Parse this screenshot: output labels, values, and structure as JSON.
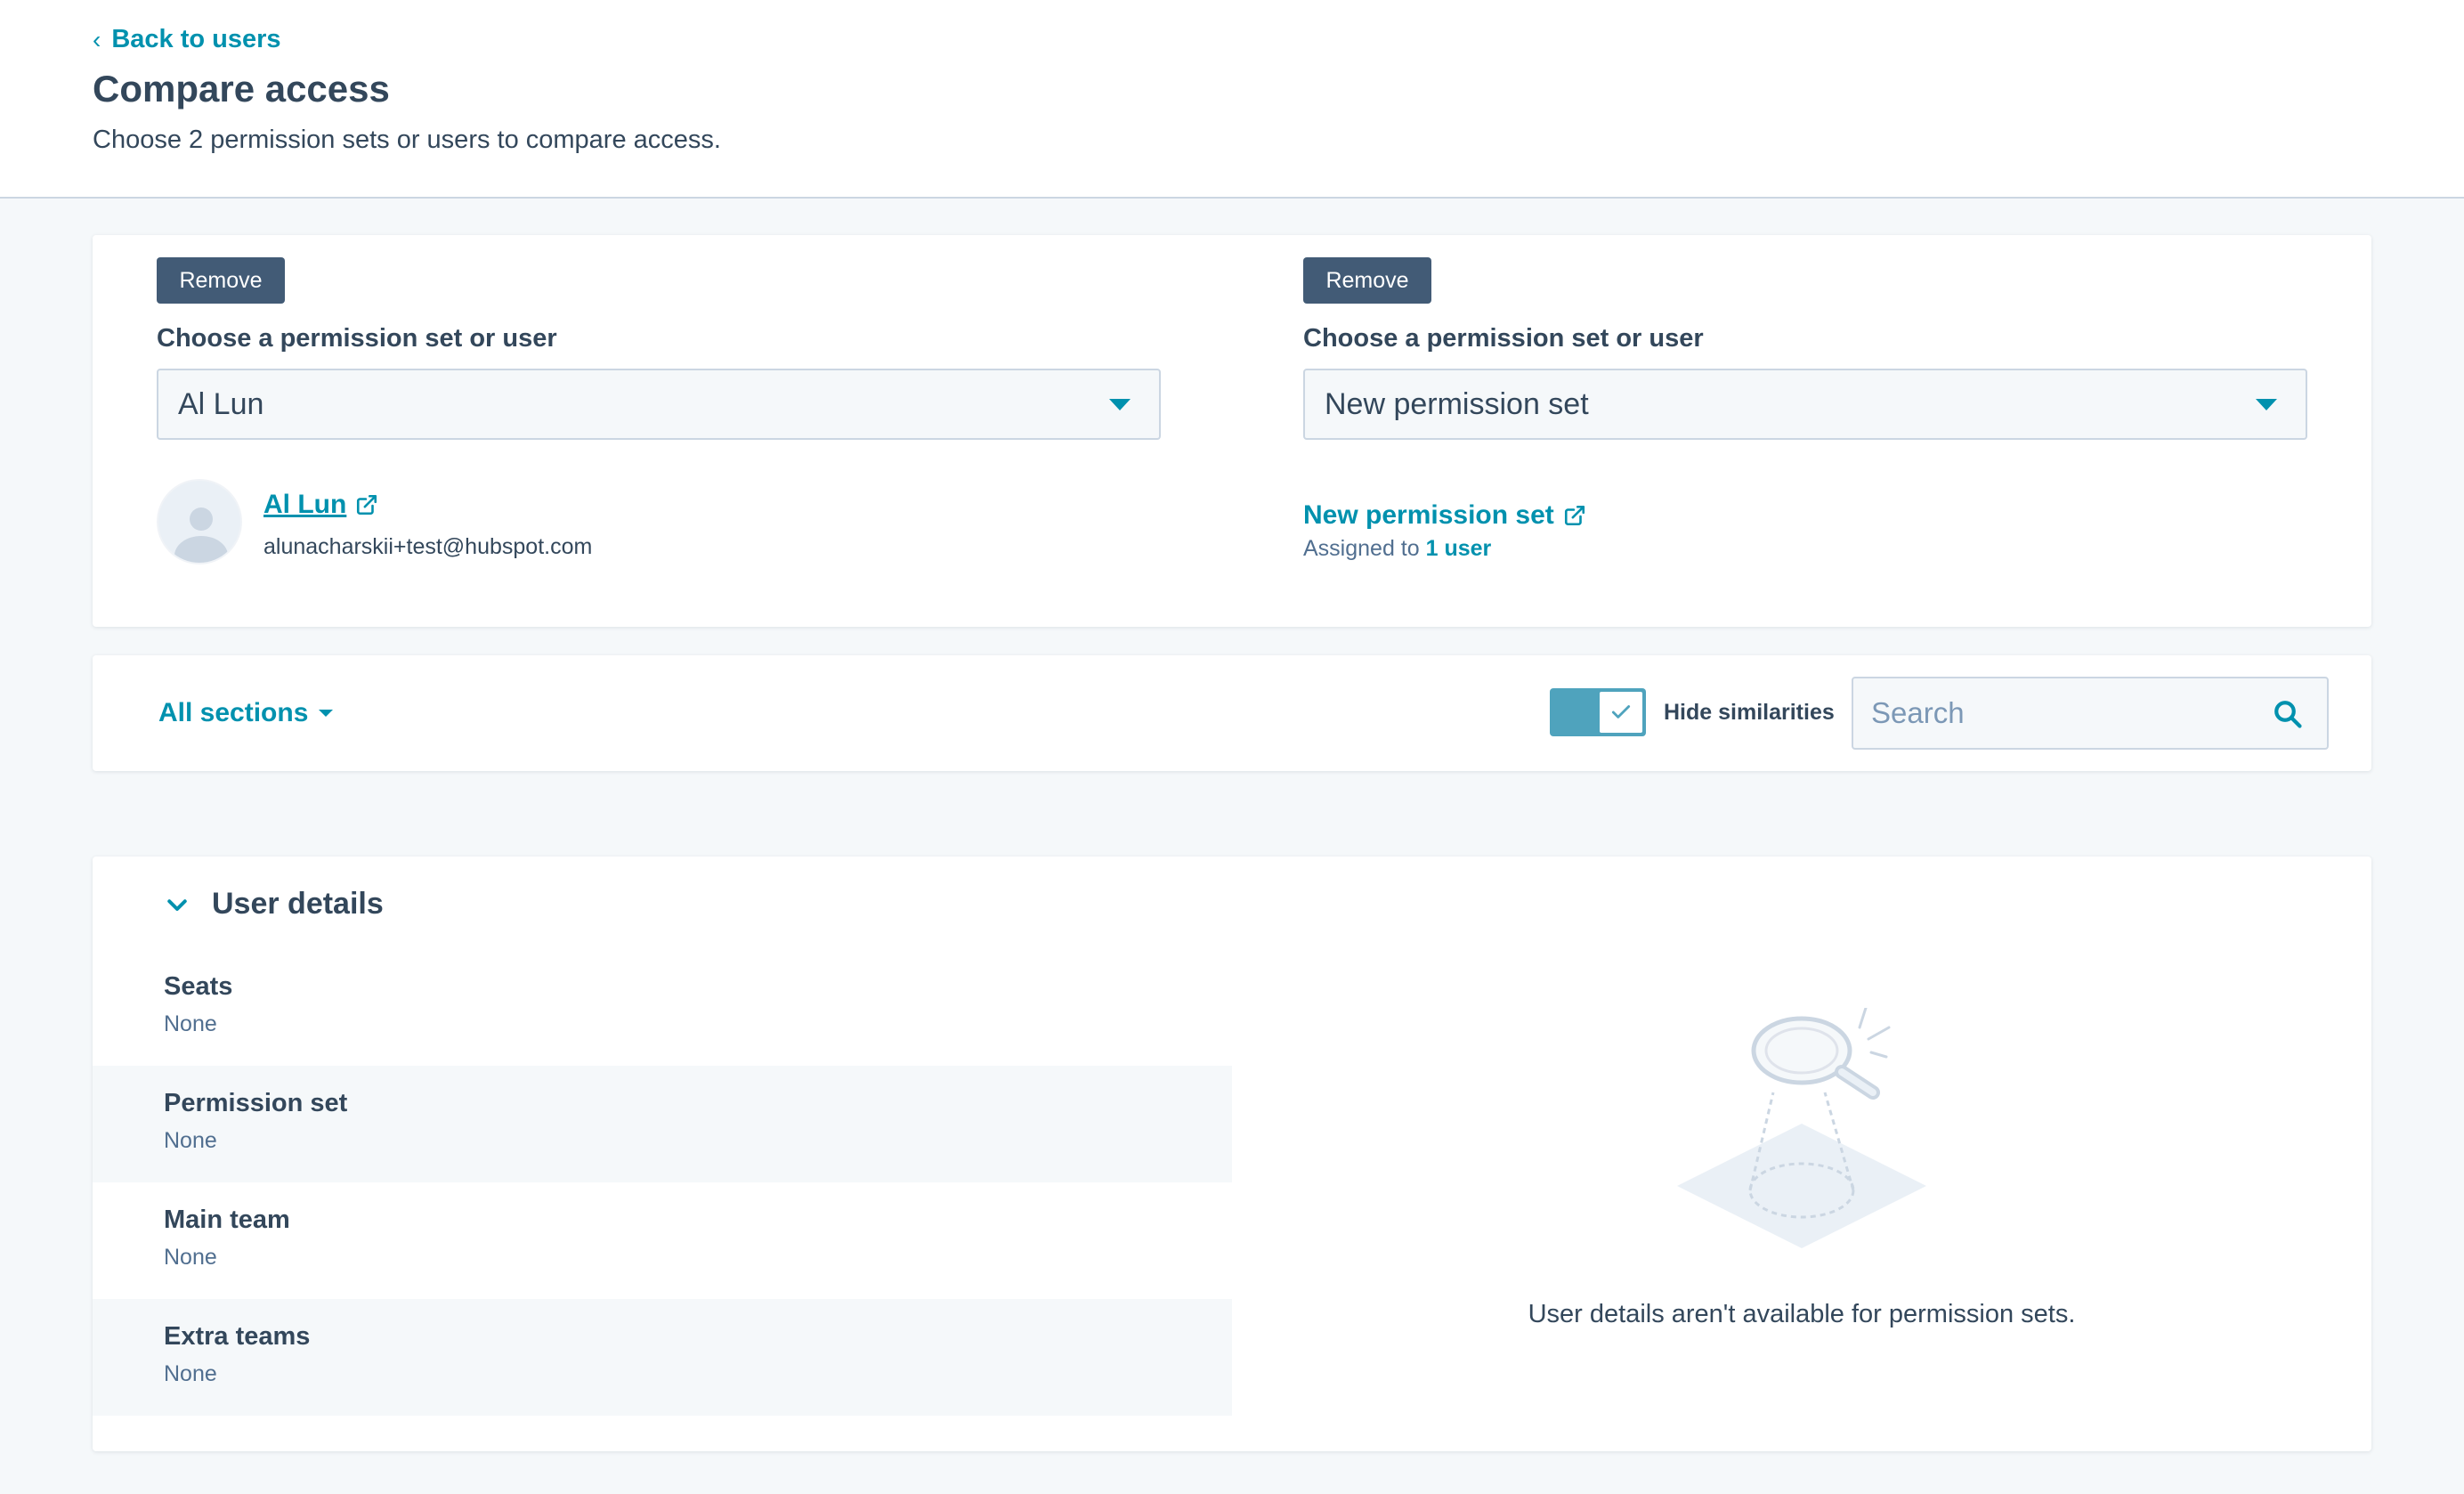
{
  "header": {
    "back_label": "Back to users",
    "title": "Compare access",
    "subtitle": "Choose 2 permission sets or users to compare access."
  },
  "left_column": {
    "remove_label": "Remove",
    "field_label": "Choose a permission set or user",
    "selected_value": "Al Lun",
    "user_name": "Al Lun",
    "user_email": "alunacharskii+test@hubspot.com"
  },
  "right_column": {
    "remove_label": "Remove",
    "field_label": "Choose a permission set or user",
    "selected_value": "New permission set",
    "perm_name": "New permission set",
    "assigned_prefix": "Assigned to",
    "assigned_link": "1 user"
  },
  "filters": {
    "sections_label": "All sections",
    "toggle_label": "Hide similarities",
    "toggle_on": true,
    "search_placeholder": "Search",
    "search_value": ""
  },
  "details": {
    "section_title": "User details",
    "rows": [
      {
        "label": "Seats",
        "value": "None"
      },
      {
        "label": "Permission set",
        "value": "None"
      },
      {
        "label": "Main team",
        "value": "None"
      },
      {
        "label": "Extra teams",
        "value": "None"
      }
    ],
    "empty_message": "User details aren't available for permission sets."
  },
  "colors": {
    "accent": "#0091ae",
    "button_dark": "#425b76",
    "toggle_on": "#4fa3bd",
    "text": "#33475b",
    "page_bg": "#f5f8fa"
  },
  "icons": {
    "back": "chevron-left-icon",
    "external": "external-link-icon",
    "dropdown": "caret-down-icon",
    "check": "check-icon",
    "search": "search-icon",
    "collapse": "chevron-down-icon",
    "empty": "magnifier-illustration"
  }
}
